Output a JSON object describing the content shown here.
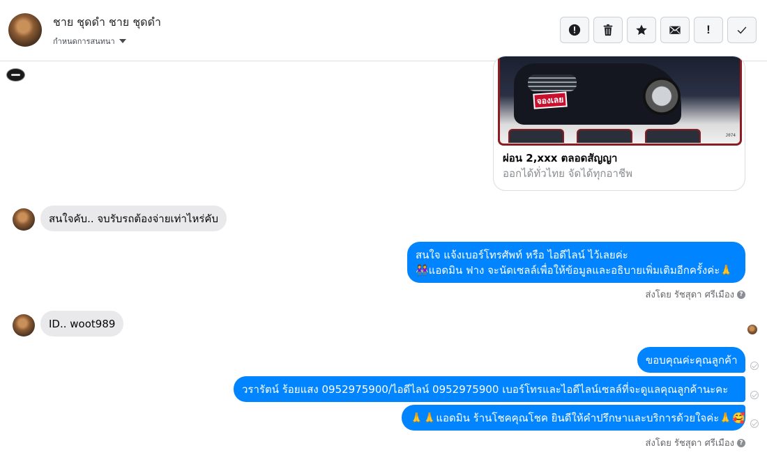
{
  "header": {
    "contact_name": "ชาย ชุดดำ ชาย ชุดดำ",
    "subtitle": "กำหนดการสนทนา",
    "avatar_icon": "user-avatar",
    "tools": [
      {
        "name": "alert-icon"
      },
      {
        "name": "trash-icon"
      },
      {
        "name": "star-icon"
      },
      {
        "name": "envelope-icon"
      },
      {
        "name": "exclamation-icon",
        "label": "!"
      },
      {
        "name": "checkmark-icon"
      }
    ]
  },
  "attachment": {
    "image_tag": "J074",
    "sticker_text": "จองเลย",
    "title": "ผ่อน 2,xxx ตลอดสัญญา",
    "subtitle": "ออกได้ทั่วไทย จัดได้ทุกอาชีพ"
  },
  "messages": [
    {
      "direction": "incoming",
      "text": "สนใจคับ.. จบรับรถต้องจ่ายเท่าไหร่คับ"
    },
    {
      "direction": "outgoing",
      "lines": [
        "สนใจ แจ้งเบอร์โทรศัพท์ หรือ ไอดีไลน์  ไว้เลยค่ะ",
        "👭แอดมิน ฟาง จะนัดเซลล์เพื่อให้ข้อมูลและอธิบายเพิ่มเติมอีกครั้งค่ะ🙏"
      ]
    },
    {
      "direction": "incoming",
      "text": "ID.. woot989"
    },
    {
      "direction": "outgoing",
      "lines": [
        "ขอบคุณค่ะคุณลูกค้า"
      ]
    },
    {
      "direction": "outgoing",
      "lines": [
        "วรารัตน์ ร้อยแสง     0952975900/ไอดีไลน์ 0952975900   เบอร์โทรและไอดีไลน์เซลล์ที่จะดูแลคุณลูกค้านะคะ"
      ]
    },
    {
      "direction": "outgoing",
      "lines": [
        "🙏🙏แอดมิน ร้านโชคคุณโชค ยินดีให้คำปรึกษาและบริการด้วยใจค่ะ🙏🥰"
      ]
    }
  ],
  "sent_by": "ส่งโดย รัชสุดา ศรีเมือง",
  "help_glyph": "?",
  "colors": {
    "outgoing_bubble": "#0084ff",
    "incoming_bubble": "#e9e9eb",
    "sticker": "#c8102e"
  }
}
